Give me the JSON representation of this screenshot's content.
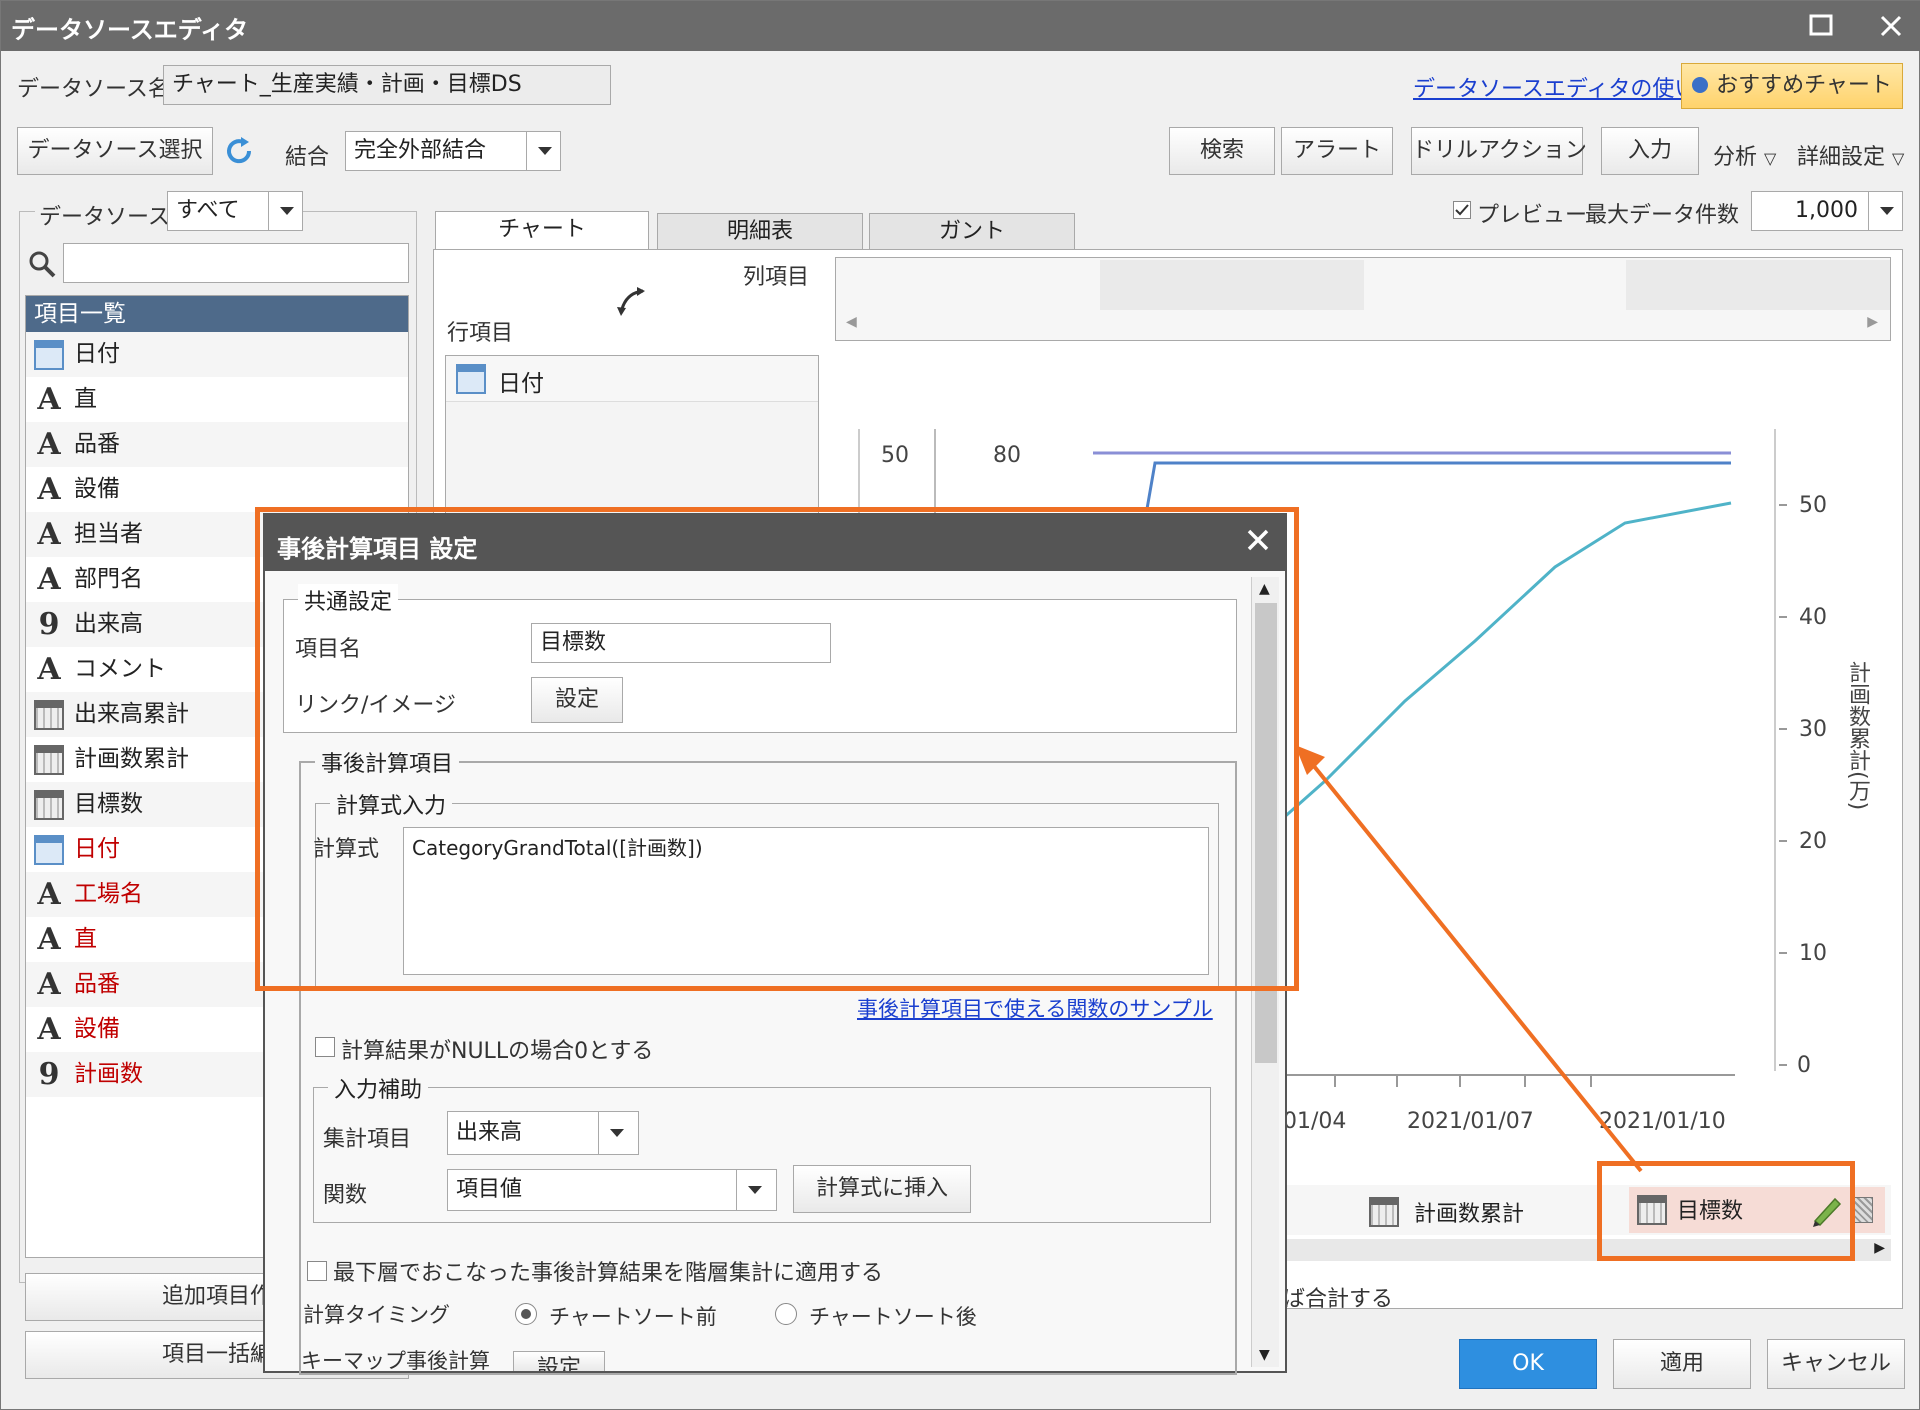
{
  "window": {
    "title": "データソースエディタ"
  },
  "header": {
    "ds_name_label": "データソース名",
    "ds_name_value": "チャート_生産実績・計画・目標DS",
    "help_link": "データソースエディタの使い方",
    "recommend_button": "おすすめチャート"
  },
  "toolbar": {
    "select_ds": "データソース選択",
    "join_label": "結合",
    "join_value": "完全外部結合",
    "search": "検索",
    "alert": "アラート",
    "drill": "ドリルアクション",
    "input": "入力",
    "analysis": "分析",
    "detail": "詳細設定"
  },
  "left": {
    "ds_label": "データソース",
    "ds_filter": "すべて",
    "list_header": "項目一覧",
    "add_button": "追加項目作",
    "bulk_button": "項目一括編",
    "items": [
      {
        "label": "日付",
        "icon": "calendar-icon",
        "red": false
      },
      {
        "label": "直",
        "icon": "text-type-icon",
        "red": false
      },
      {
        "label": "品番",
        "icon": "text-type-icon",
        "red": false
      },
      {
        "label": "設備",
        "icon": "text-type-icon",
        "red": false
      },
      {
        "label": "担当者",
        "icon": "text-type-icon",
        "red": false
      },
      {
        "label": "部門名",
        "icon": "text-type-icon",
        "red": false
      },
      {
        "label": "出来高",
        "icon": "number-type-icon",
        "red": false
      },
      {
        "label": "コメント",
        "icon": "text-type-icon",
        "red": false
      },
      {
        "label": "出来高累計",
        "icon": "calculator-icon",
        "red": false
      },
      {
        "label": "計画数累計",
        "icon": "calculator-icon",
        "red": false
      },
      {
        "label": "目標数",
        "icon": "calculator-icon",
        "red": false
      },
      {
        "label": "日付",
        "icon": "calendar-icon",
        "red": true
      },
      {
        "label": "工場名",
        "icon": "text-type-icon",
        "red": true
      },
      {
        "label": "直",
        "icon": "text-type-icon",
        "red": true
      },
      {
        "label": "品番",
        "icon": "text-type-icon",
        "red": true
      },
      {
        "label": "設備",
        "icon": "text-type-icon",
        "red": true
      },
      {
        "label": "計画数",
        "icon": "number-type-icon",
        "red": true
      }
    ]
  },
  "main": {
    "tabs": [
      "チャート",
      "明細表",
      "ガント"
    ],
    "preview_label": "プレビュー",
    "max_rows_label": "最大データ件数",
    "max_rows_value": "1,000",
    "col_label": "列項目",
    "row_label": "行項目",
    "row_item": "日付",
    "value_items": [
      "計画数累計",
      "目標数"
    ],
    "footer_text": "ば合計する",
    "ok": "OK",
    "apply": "適用",
    "cancel": "キャンセル"
  },
  "chart_data": {
    "type": "line",
    "left_axis_ticks": [
      "50",
      "80"
    ],
    "right_axis_ticks": [
      "0",
      "10",
      "20",
      "30",
      "40",
      "50"
    ],
    "ylabel_right": "計画数累計(万)",
    "x_tick_labels": [
      "01/04",
      "2021/01/07",
      "2021/01/10"
    ],
    "series": [
      {
        "color": "#8a8fd6"
      },
      {
        "color": "#4f82c8"
      },
      {
        "color": "#4fb3c8"
      }
    ]
  },
  "dialog": {
    "title": "事後計算項目 設定",
    "common_group": "共通設定",
    "item_name_label": "項目名",
    "item_name_value": "目標数",
    "link_label": "リンク/イメージ",
    "link_button": "設定",
    "calc_group": "事後計算項目",
    "formula_group": "計算式入力",
    "formula_label": "計算式",
    "formula_value": "CategoryGrandTotal([計画数])",
    "sample_link": "事後計算項目で使える関数のサンプル",
    "null_check": "計算結果がNULLの場合0とする",
    "assist_group": "入力補助",
    "agg_label": "集計項目",
    "agg_value": "出来高",
    "func_label": "関数",
    "func_value": "項目値",
    "insert_button": "計算式に挿入",
    "lowest_check": "最下層でおこなった事後計算結果を階層集計に適用する",
    "timing_label": "計算タイミング",
    "timing_before": "チャートソート前",
    "timing_after": "チャートソート後",
    "keymap_label": "キーマップ事後計算",
    "keymap_button": "設定"
  }
}
